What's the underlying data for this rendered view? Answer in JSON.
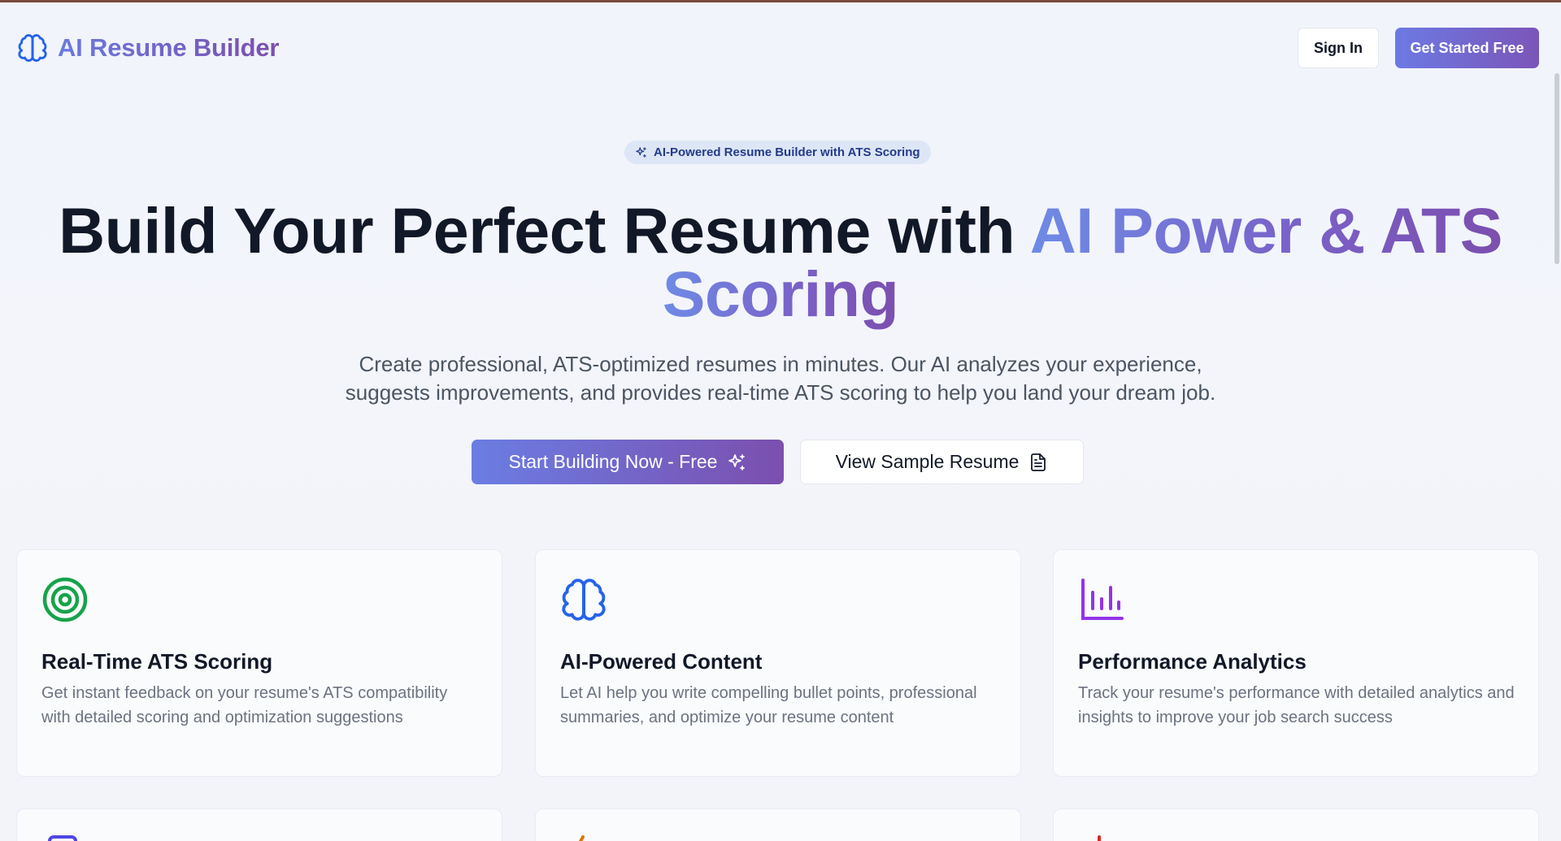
{
  "header": {
    "brand_icon": "brain-icon",
    "brand_name": "AI Resume Builder",
    "signin_label": "Sign In",
    "getstarted_label": "Get Started Free"
  },
  "hero": {
    "badge_icon": "sparkles-icon",
    "badge_text": "AI-Powered Resume Builder with ATS Scoring",
    "title_plain": "Build Your Perfect Resume with ",
    "title_accent_1": "AI Power & ATS",
    "title_accent_2": "Scoring",
    "subtitle_line1": "Create professional, ATS-optimized resumes in minutes. Our AI analyzes your experience,",
    "subtitle_line2": "suggests improvements, and provides real-time ATS scoring to help you land your dream job.",
    "cta_primary_label": "Start Building Now - Free",
    "cta_primary_icon": "sparkles-icon",
    "cta_secondary_label": "View Sample Resume",
    "cta_secondary_icon": "document-icon"
  },
  "features": [
    {
      "icon": "target-icon",
      "title": "Real-Time ATS Scoring",
      "text": "Get instant feedback on your resume's ATS compatibility with detailed scoring and optimization suggestions",
      "color": "#16a34a"
    },
    {
      "icon": "brain-icon",
      "title": "AI-Powered Content",
      "text": "Let AI help you write compelling bullet points, professional summaries, and optimize your resume content",
      "color": "#2563eb"
    },
    {
      "icon": "bar-chart-icon",
      "title": "Performance Analytics",
      "text": "Track your resume's performance with detailed analytics and insights to improve your job search success",
      "color": "#9333ea"
    }
  ],
  "colors": {
    "accent_start": "#6c7ae3",
    "accent_end": "#7b4fae",
    "heading": "#111827",
    "body_text": "#6b7280"
  }
}
